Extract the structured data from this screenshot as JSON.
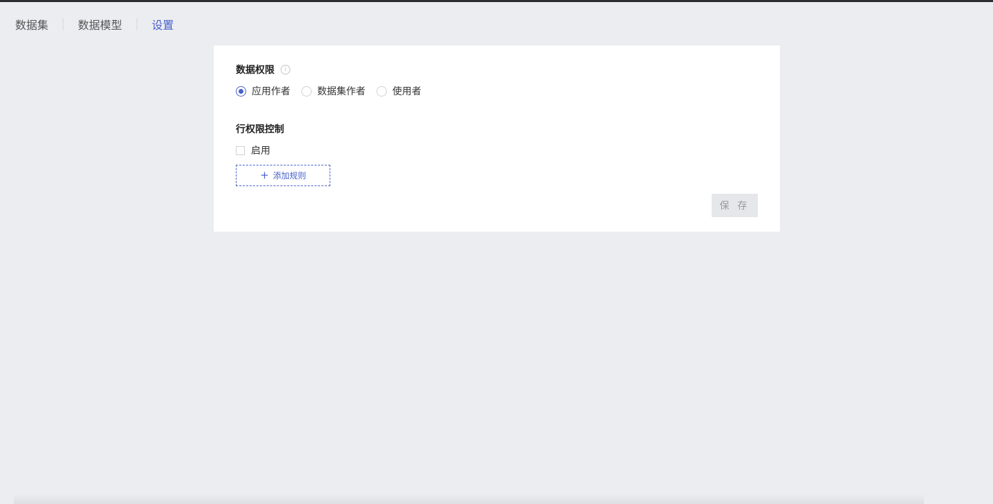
{
  "tabs": [
    {
      "label": "数据集",
      "active": false
    },
    {
      "label": "数据模型",
      "active": false
    },
    {
      "label": "设置",
      "active": true
    }
  ],
  "settings": {
    "data_permission": {
      "title": "数据权限",
      "info_icon": "info-icon",
      "options": [
        {
          "label": "应用作者",
          "checked": true
        },
        {
          "label": "数据集作者",
          "checked": false
        },
        {
          "label": "使用者",
          "checked": false
        }
      ]
    },
    "row_permission": {
      "title": "行权限控制",
      "enable_label": "启用",
      "enabled": false,
      "add_rule_label": "添加规则"
    },
    "save_label": "保 存"
  },
  "colors": {
    "accent": "#4a61c9",
    "background": "#ecedf1",
    "panel": "#ffffff"
  }
}
